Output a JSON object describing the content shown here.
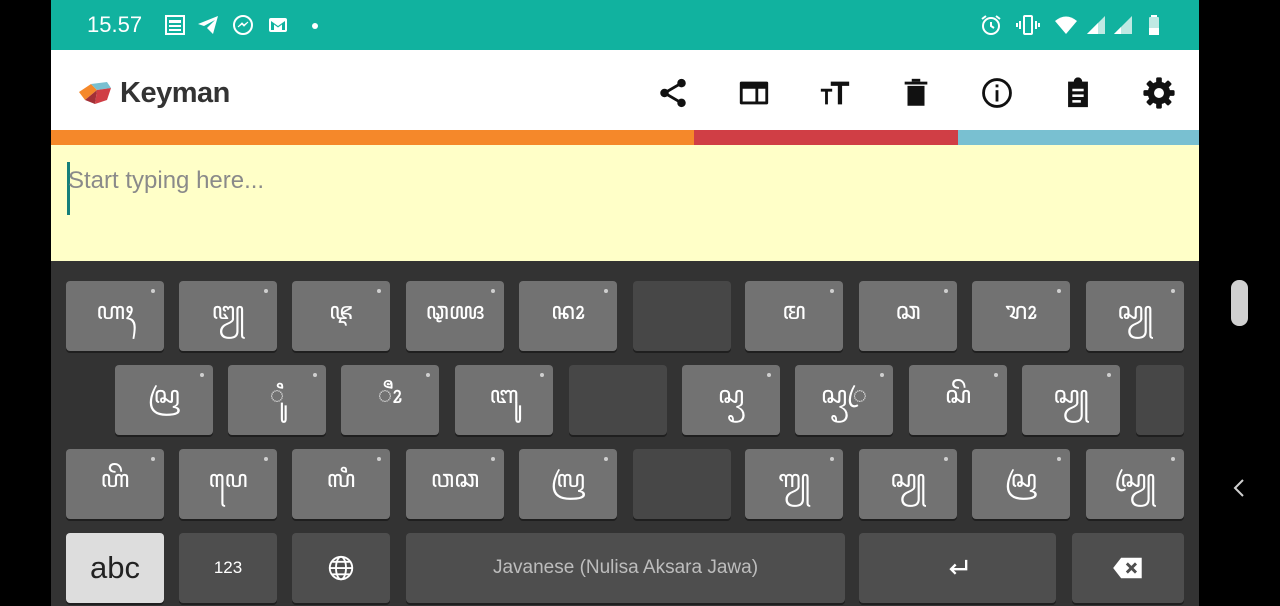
{
  "status_bar": {
    "time": "15.57",
    "left_icons": [
      "jazz-icon",
      "telegram-icon",
      "messenger-icon",
      "gmail-icon",
      "dot-icon"
    ],
    "right_icons": [
      "alarm-icon",
      "vibrate-icon",
      "wifi-icon",
      "signal-icon",
      "signal-icon",
      "battery-icon"
    ]
  },
  "app_bar": {
    "title": "Keyman",
    "actions": [
      "share-icon",
      "web-browser-icon",
      "text-size-icon",
      "delete-icon",
      "info-icon",
      "clipboard-icon",
      "settings-icon"
    ]
  },
  "colors": {
    "status_bar": "#11b29f",
    "stripe_orange": "#f5882a",
    "stripe_red": "#d03e45",
    "stripe_blue": "#79c0d1",
    "text_area": "#ffffc8",
    "cursor": "#157f7a"
  },
  "editor": {
    "placeholder": "Start typing here..."
  },
  "keyboard": {
    "row1": [
      "ꦲꦃ",
      "ꦔꦾ",
      "ꦘ",
      "ꦡꦖ",
      "ꦤꦴ",
      "",
      "ꦩ",
      "ꦕ",
      "ꦫꦴ",
      "ꦱꦾ"
    ],
    "row2": [
      "ꦱꦿ",
      "ꦶꦸ",
      "ꦷꦴ",
      "ꦧꦸ",
      "",
      "ꦱꦽ",
      "ꦱꦽꦿ",
      "ꦱꦼ",
      "ꦱꦾ",
      ""
    ],
    "row3": [
      "ꦲꦼ",
      "ꦥꦺ",
      "ꦭꦶ",
      "ꦮꦕ",
      "ꦭꦿ",
      "",
      "ꦒꦾ",
      "ꦱꦾ",
      "ꦱꦿ",
      "ꦱꦿꦾ"
    ],
    "bottom": {
      "abc": "abc",
      "numeric": "123",
      "globe_icon": "globe-icon",
      "space_label": "Javanese (Nulisa Aksara Jawa)",
      "enter_icon": "enter-icon",
      "backspace_icon": "backspace-icon"
    }
  }
}
